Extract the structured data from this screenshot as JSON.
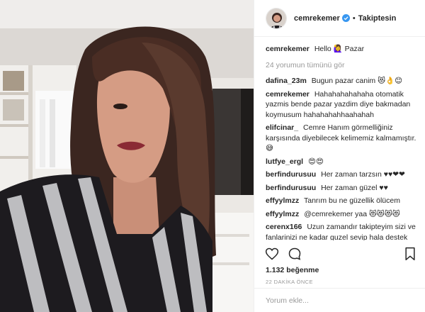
{
  "header": {
    "username": "cemrekemer",
    "follow_label": "Takiptesin",
    "dot": "•"
  },
  "caption": {
    "username": "cemrekemer",
    "text": "Hello 🙋‍♀️ Pazar"
  },
  "view_all": "24 yorumun tümünü gör",
  "comments": [
    {
      "user": "dafina_23m",
      "text": "Bugun pazar canim 😻👌😊"
    },
    {
      "user": "cemrekemer",
      "text": "Hahahahahahaha otomatik yazmis bende pazar yazdim diye bakmadan koymusum hahahahahhaahahah"
    },
    {
      "user": "elifcinar_",
      "text": "Cemre Hanım görmelliğiniz karşısında diyebilecek kelimemiz kalmamıştır.😅"
    },
    {
      "user": "lutfye_ergl",
      "text": "😍😍"
    },
    {
      "user": "berfindurusuu",
      "text": "Her zaman tarzsın ♥♥❤❤"
    },
    {
      "user": "berfindurusuu",
      "text": "Her zaman güzel ♥♥"
    },
    {
      "user": "effyylmzz",
      "text": "Tanrım bu ne güzellik ölücem"
    },
    {
      "user": "effyylmzz",
      "text": "@cemrekemer yaa 😻😻😻😻"
    },
    {
      "user": "cerenx166",
      "text": "Uzun zamandır takipteyim sizi ve fanlarinizi ne kadar guzel sevip hala destek"
    }
  ],
  "likes": "1.132 beğenme",
  "time": "22 DAKİKA ÖNCE",
  "add_comment_placeholder": "Yorum ekle...",
  "icons": {
    "like": "heart-icon",
    "comment": "comment-icon",
    "save": "bookmark-icon",
    "verified": "verified-badge-icon"
  },
  "colors": {
    "verified": "#3897f0",
    "muted": "#999999",
    "text": "#262626"
  }
}
